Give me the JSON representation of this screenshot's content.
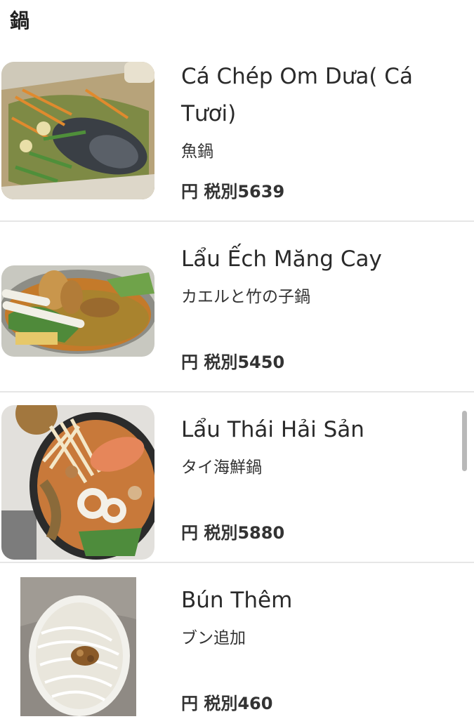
{
  "section": {
    "title": "鍋"
  },
  "items": [
    {
      "name": "Cá Chép Om Dưa( Cá Tươi)",
      "jp_name": "魚鍋",
      "price": "円 税別5639",
      "thumb_icon": "fish-hotpot-photo"
    },
    {
      "name": "Lẩu Ếch Măng Cay",
      "jp_name": "カエルと竹の子鍋",
      "price": "円 税別5450",
      "thumb_icon": "frog-hotpot-photo"
    },
    {
      "name": "Lẩu Thái Hải Sản",
      "jp_name": "タイ海鮮鍋",
      "price": "円 税別5880",
      "thumb_icon": "seafood-hotpot-photo"
    },
    {
      "name": "Bún Thêm",
      "jp_name": "ブン追加",
      "price": "円 税別460",
      "thumb_icon": "rice-noodle-photo"
    }
  ]
}
